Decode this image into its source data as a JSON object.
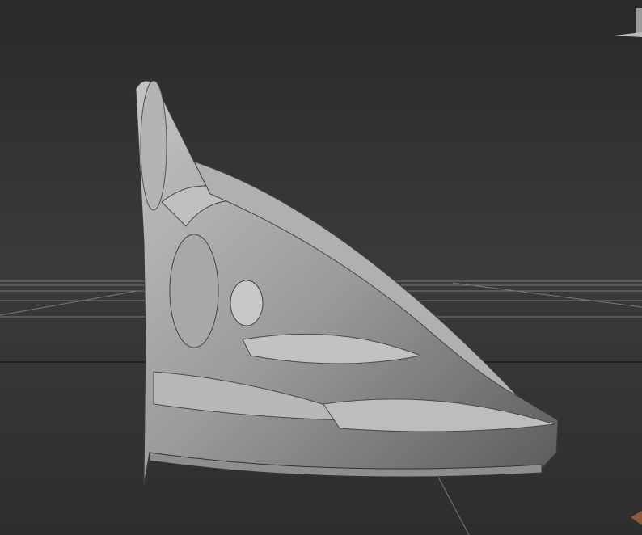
{
  "viewport": {
    "background_top": "#2a2a2a",
    "background_bottom": "#2e2e2e",
    "grid_color": "#8a8a8a",
    "model_color": "#9c9c9c",
    "model_highlight": "#c8c8c8",
    "model_shadow": "#3c3c3c"
  }
}
